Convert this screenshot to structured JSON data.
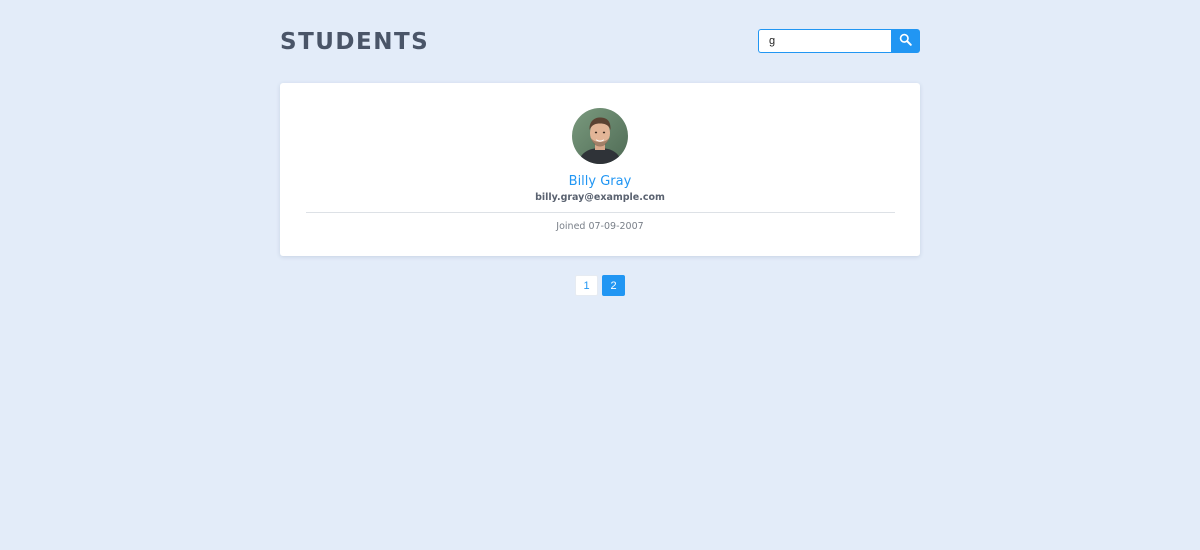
{
  "header": {
    "title": "STUDENTS"
  },
  "search": {
    "value": "g",
    "icon": "search-icon"
  },
  "student": {
    "name": "Billy Gray",
    "email": "billy.gray@example.com",
    "joined": "Joined 07-09-2007"
  },
  "pagination": {
    "pages": [
      "1",
      "2"
    ],
    "current": "2"
  },
  "colors": {
    "background": "#e3ecf9",
    "accent": "#2196f3",
    "title": "#4a5568"
  }
}
